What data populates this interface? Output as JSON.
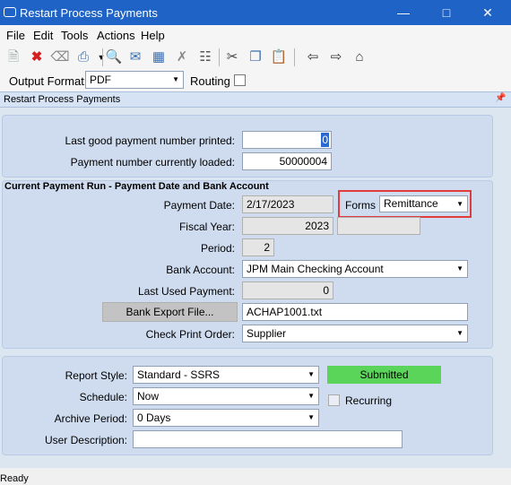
{
  "window": {
    "title": "Restart Process Payments"
  },
  "menu": [
    "File",
    "Edit",
    "Tools",
    "Actions",
    "Help"
  ],
  "output": {
    "format_label": "Output Format:",
    "format_value": "PDF",
    "routing_label": "Routing"
  },
  "panel_title": "Restart Process Payments",
  "top_section": {
    "last_good_label": "Last good payment number printed:",
    "last_good_value": "0",
    "currently_loaded_label": "Payment number currently loaded:",
    "currently_loaded_value": "50000004"
  },
  "run_section": {
    "heading": "Current Payment Run - Payment Date and Bank Account",
    "payment_date_label": "Payment Date:",
    "payment_date_value": "2/17/2023",
    "forms_label": "Forms",
    "forms_value": "Remittance",
    "fiscal_year_label": "Fiscal Year:",
    "fiscal_year_value": "2023",
    "period_label": "Period:",
    "period_value": "2",
    "bank_account_label": "Bank Account:",
    "bank_account_value": "JPM Main Checking Account",
    "last_used_label": "Last Used Payment:",
    "last_used_value": "0",
    "bank_export_button": "Bank Export File...",
    "bank_export_value": "ACHAP1001.txt",
    "check_order_label": "Check Print Order:",
    "check_order_value": "Supplier"
  },
  "report_section": {
    "report_style_label": "Report Style:",
    "report_style_value": "Standard - SSRS",
    "status_value": "Submitted",
    "schedule_label": "Schedule:",
    "schedule_value": "Now",
    "recurring_label": "Recurring",
    "archive_label": "Archive Period:",
    "archive_value": "0 Days",
    "description_label": "User Description:",
    "description_value": ""
  },
  "status_bar": "Ready",
  "colors": {
    "title_bar": "#1f63c6",
    "submitted": "#5ad55a",
    "highlight_border": "#e03c3c"
  },
  "icons": [
    "new-icon",
    "delete-icon",
    "clear-icon",
    "print-icon",
    "print-preview-icon",
    "attach-icon",
    "layout-icon",
    "remove-icon",
    "export-icon",
    "cut-icon",
    "copy-icon",
    "paste-icon",
    "back-icon",
    "forward-icon",
    "home-icon"
  ]
}
